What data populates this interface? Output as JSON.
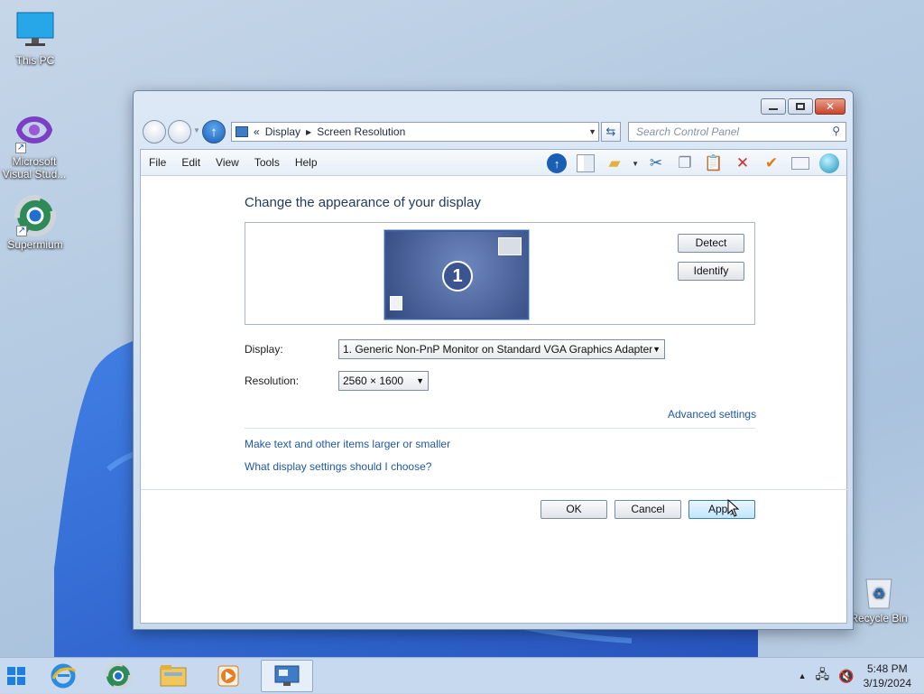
{
  "desktop": {
    "icons": [
      {
        "label": "This PC"
      },
      {
        "label": "Microsoft Visual Stud..."
      },
      {
        "label": "Supermium"
      },
      {
        "label": "Recycle Bin"
      }
    ]
  },
  "window": {
    "address": {
      "chevrons": "«",
      "crumbs": [
        "Display",
        "Screen Resolution"
      ]
    },
    "search_placeholder": "Search Control Panel",
    "menu": [
      "File",
      "Edit",
      "View",
      "Tools",
      "Help"
    ],
    "heading": "Change the appearance of your display",
    "monitor_number": "1",
    "detect_label": "Detect",
    "identify_label": "Identify",
    "display_label": "Display:",
    "display_value": "1. Generic Non-PnP Monitor on Standard VGA Graphics Adapter",
    "resolution_label": "Resolution:",
    "resolution_value": "2560 × 1600",
    "advanced_link": "Advanced settings",
    "links": [
      "Make text and other items larger or smaller",
      "What display settings should I choose?"
    ],
    "ok_label": "OK",
    "cancel_label": "Cancel",
    "apply_label": "Apply"
  },
  "taskbar": {
    "time": "5:48 PM",
    "date": "3/19/2024"
  },
  "colors": {
    "link": "#1f58a5",
    "heading": "#1e395b",
    "accent": "#1a5fb4"
  }
}
